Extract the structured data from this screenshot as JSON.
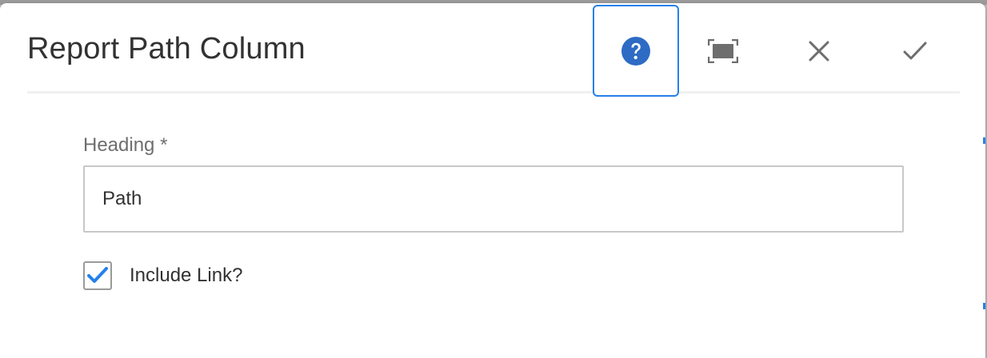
{
  "dialog": {
    "title": "Report Path Column",
    "actions": {
      "help": "help-icon",
      "fullscreen": "fullscreen-icon",
      "close": "close-icon",
      "done": "checkmark-icon"
    }
  },
  "form": {
    "heading_label": "Heading *",
    "heading_value": "Path",
    "include_link_label": "Include Link?",
    "include_link_checked": true
  },
  "colors": {
    "accent": "#2680eb",
    "help_icon": "#2d6bc4",
    "text": "#323232",
    "label": "#6e6e6e"
  }
}
